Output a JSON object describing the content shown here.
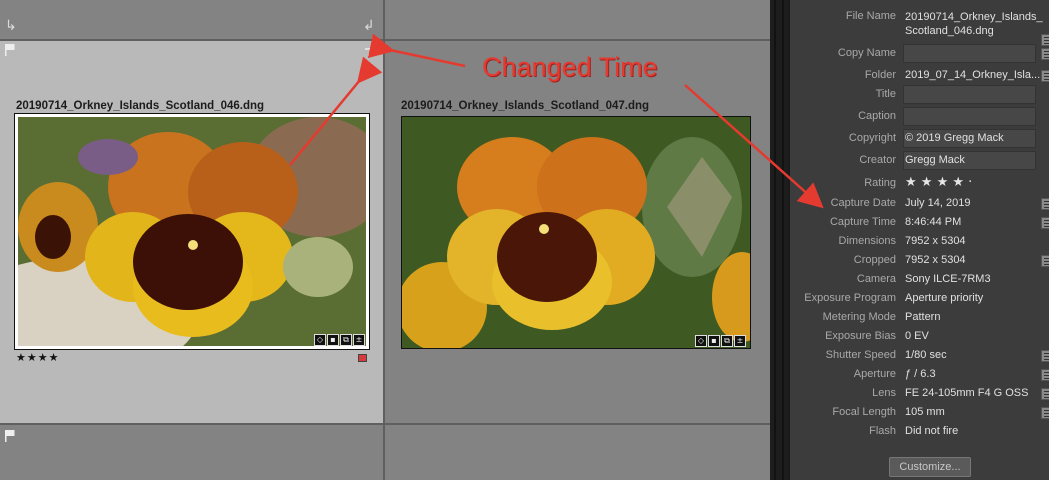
{
  "grid": {
    "photos": [
      {
        "filename": "20190714_Orkney_Islands_Scotland_046.dng",
        "rating": "★★★★"
      },
      {
        "filename": "20190714_Orkney_Islands_Scotland_047.dng"
      }
    ]
  },
  "annotation": {
    "text": "Changed Time",
    "color": "#e43a2f"
  },
  "metadata": {
    "fields": [
      {
        "label": "File Name",
        "value": "20190714_Orkney_Islands_\nScotland_046.dng"
      },
      {
        "label": "Copy Name",
        "value": ""
      },
      {
        "label": "Folder",
        "value": "2019_07_14_Orkney_Isla..."
      },
      {
        "label": "Title",
        "value": ""
      },
      {
        "label": "Caption",
        "value": ""
      },
      {
        "label": "Copyright",
        "value": "© 2019 Gregg Mack"
      },
      {
        "label": "Creator",
        "value": "Gregg Mack"
      },
      {
        "label": "Rating",
        "value": "★ ★ ★ ★ ·"
      },
      {
        "label": "Capture Date",
        "value": "July 14, 2019"
      },
      {
        "label": "Capture Time",
        "value": "8:46:44 PM"
      },
      {
        "label": "Dimensions",
        "value": "7952 x 5304"
      },
      {
        "label": "Cropped",
        "value": "7952 x 5304"
      },
      {
        "label": "Camera",
        "value": "Sony ILCE-7RM3"
      },
      {
        "label": "Exposure Program",
        "value": "Aperture priority"
      },
      {
        "label": "Metering Mode",
        "value": "Pattern"
      },
      {
        "label": "Exposure Bias",
        "value": "0 EV"
      },
      {
        "label": "Shutter Speed",
        "value": "1/80 sec"
      },
      {
        "label": "Aperture",
        "value": "ƒ / 6.3"
      },
      {
        "label": "Lens",
        "value": "FE 24-105mm F4 G OSS"
      },
      {
        "label": "Focal Length",
        "value": "105 mm"
      },
      {
        "label": "Flash",
        "value": "Did not fire"
      }
    ],
    "customize_label": "Customize..."
  },
  "colors": {
    "selected_cell": "#b9b9b9",
    "grid_bg": "#7f7f7f",
    "panel_bg": "#3c3c3c",
    "label_red": "#d63a3a"
  }
}
